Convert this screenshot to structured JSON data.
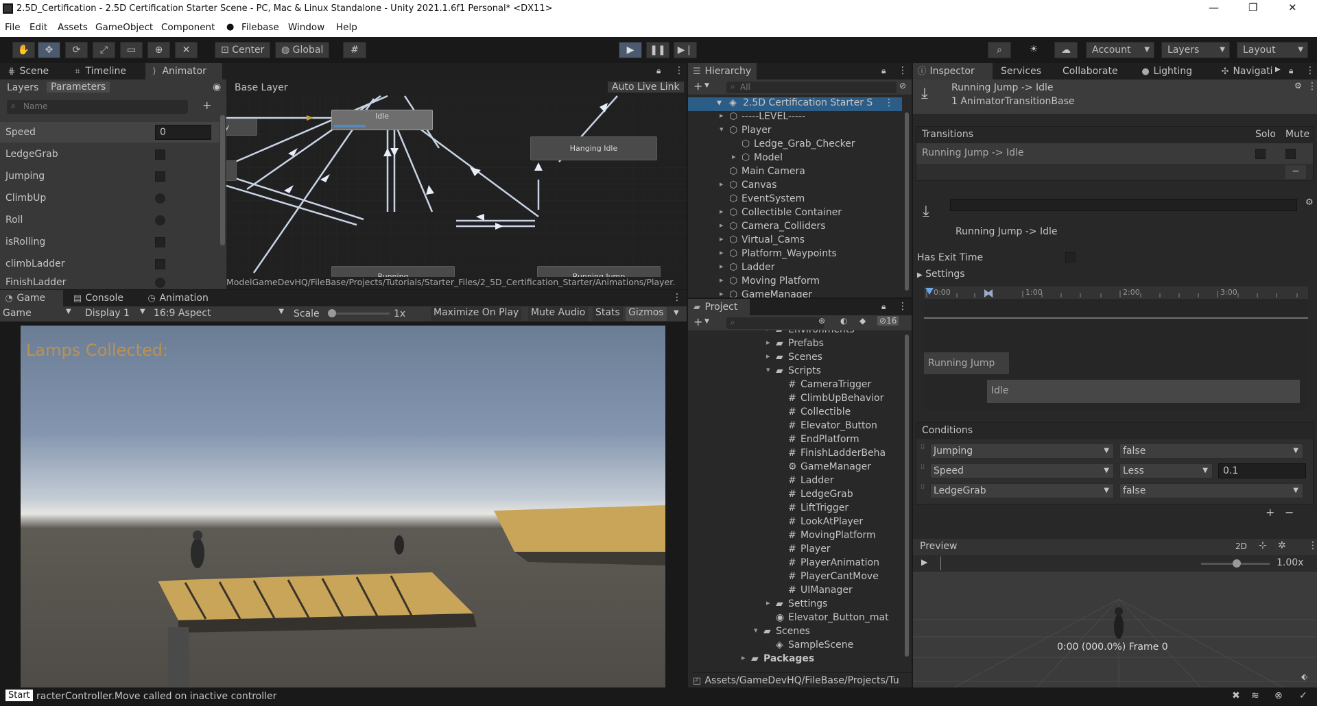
{
  "window": {
    "title": "2.5D_Certification - 2.5D Certification Starter Scene - PC, Mac & Linux Standalone - Unity 2021.1.6f1 Personal* <DX11>",
    "minimize": "—",
    "maximize": "❐",
    "close": "✕"
  },
  "menu": [
    "File",
    "Edit",
    "Assets",
    "GameObject",
    "Component",
    "Filebase",
    "Window",
    "Help"
  ],
  "toolbar": {
    "center": "Center",
    "global": "Global",
    "account": "Account",
    "layers": "Layers",
    "layout": "Layout"
  },
  "animator": {
    "tabs": [
      "Scene",
      "Timeline",
      "Animator"
    ],
    "subtabs": [
      "Layers",
      "Parameters"
    ],
    "search_placeholder": "Name",
    "layer": "Base Layer",
    "auto_live_link": "Auto Live Link",
    "path": "ModelGameDevHQ/FileBase/Projects/Tutorials/Starter_Files/2_5D_Certification_Starter/Animations/Player.",
    "parameters": [
      {
        "name": "Speed",
        "type": "float",
        "value": "0"
      },
      {
        "name": "LedgeGrab",
        "type": "bool"
      },
      {
        "name": "Jumping",
        "type": "bool"
      },
      {
        "name": "ClimbUp",
        "type": "trigger"
      },
      {
        "name": "Roll",
        "type": "trigger"
      },
      {
        "name": "isRolling",
        "type": "bool"
      },
      {
        "name": "climbLadder",
        "type": "bool"
      },
      {
        "name": "FinishLadder",
        "type": "trigger"
      }
    ],
    "states": {
      "idle": "Idle",
      "hanging_idle": "Hanging Idle",
      "running": "Running",
      "running_jump": "Running Jump",
      "partial": "y"
    }
  },
  "game": {
    "tabs": [
      "Game",
      "Console",
      "Animation"
    ],
    "display_mode": "Game",
    "display": "Display 1",
    "aspect": "16:9 Aspect",
    "scale_label": "Scale",
    "scale_value": "1x",
    "buttons": [
      "Maximize On Play",
      "Mute Audio",
      "Stats",
      "Gizmos"
    ],
    "hud_text": "Lamps Collected:"
  },
  "hierarchy": {
    "tab": "Hierarchy",
    "search_placeholder": "All",
    "scene": "2.5D Certification Starter S",
    "items": [
      {
        "label": "-----LEVEL-----",
        "indent": 1,
        "fold": "▸"
      },
      {
        "label": "Player",
        "indent": 1,
        "fold": "▾"
      },
      {
        "label": "Ledge_Grab_Checker",
        "indent": 2,
        "fold": ""
      },
      {
        "label": "Model",
        "indent": 2,
        "fold": "▸"
      },
      {
        "label": "Main Camera",
        "indent": 1,
        "fold": ""
      },
      {
        "label": "Canvas",
        "indent": 1,
        "fold": "▸"
      },
      {
        "label": "EventSystem",
        "indent": 1,
        "fold": ""
      },
      {
        "label": "Collectible Container",
        "indent": 1,
        "fold": "▸"
      },
      {
        "label": "Camera_Colliders",
        "indent": 1,
        "fold": "▸"
      },
      {
        "label": "Virtual_Cams",
        "indent": 1,
        "fold": "▸"
      },
      {
        "label": "Platform_Waypoints",
        "indent": 1,
        "fold": "▸"
      },
      {
        "label": "Ladder",
        "indent": 1,
        "fold": "▸"
      },
      {
        "label": "Moving Platform",
        "indent": 1,
        "fold": "▸"
      },
      {
        "label": "GameManager",
        "indent": 1,
        "fold": "▸"
      }
    ]
  },
  "project": {
    "tab": "Project",
    "hidden_count": "16",
    "items": [
      {
        "label": "Environments",
        "type": "folder",
        "indent": 1,
        "fold": "▸"
      },
      {
        "label": "Prefabs",
        "type": "folder",
        "indent": 1,
        "fold": "▸"
      },
      {
        "label": "Scenes",
        "type": "folder",
        "indent": 1,
        "fold": "▸"
      },
      {
        "label": "Scripts",
        "type": "folder",
        "indent": 1,
        "fold": "▾"
      },
      {
        "label": "CameraTrigger",
        "type": "script",
        "indent": 2
      },
      {
        "label": "ClimbUpBehavior",
        "type": "script",
        "indent": 2
      },
      {
        "label": "Collectible",
        "type": "script",
        "indent": 2
      },
      {
        "label": "Elevator_Button",
        "type": "script",
        "indent": 2
      },
      {
        "label": "EndPlatform",
        "type": "script",
        "indent": 2
      },
      {
        "label": "FinishLadderBeha",
        "type": "script",
        "indent": 2
      },
      {
        "label": "GameManager",
        "type": "gear",
        "indent": 2
      },
      {
        "label": "Ladder",
        "type": "script",
        "indent": 2
      },
      {
        "label": "LedgeGrab",
        "type": "script",
        "indent": 2
      },
      {
        "label": "LiftTrigger",
        "type": "script",
        "indent": 2
      },
      {
        "label": "LookAtPlayer",
        "type": "script",
        "indent": 2
      },
      {
        "label": "MovingPlatform",
        "type": "script",
        "indent": 2
      },
      {
        "label": "Player",
        "type": "script",
        "indent": 2
      },
      {
        "label": "PlayerAnimation",
        "type": "script",
        "indent": 2
      },
      {
        "label": "PlayerCantMove",
        "type": "script",
        "indent": 2
      },
      {
        "label": "UIManager",
        "type": "script",
        "indent": 2
      },
      {
        "label": "Settings",
        "type": "folder",
        "indent": 1,
        "fold": "▸"
      },
      {
        "label": "Elevator_Button_mat",
        "type": "material",
        "indent": 1
      },
      {
        "label": "Scenes",
        "type": "folder",
        "indent": 0,
        "fold": "▾"
      },
      {
        "label": "SampleScene",
        "type": "scene",
        "indent": 1
      },
      {
        "label": "Packages",
        "type": "folder",
        "indent": -1,
        "fold": "▸"
      }
    ],
    "path": "Assets/GameDevHQ/FileBase/Projects/Tu"
  },
  "inspector": {
    "tabs": [
      "Inspector",
      "Services",
      "Collaborate",
      "Lighting",
      "Navigati"
    ],
    "header_title": "Running Jump -> Idle",
    "header_sub": "1 AnimatorTransitionBase",
    "transitions_label": "Transitions",
    "solo": "Solo",
    "mute": "Mute",
    "transition_row": "Running Jump -> Idle",
    "transition_name": "Running Jump -> Idle",
    "has_exit_time": "Has Exit Time",
    "settings": "Settings",
    "timeline_ticks": [
      "0:00",
      "1:00",
      "2:00",
      "3:00"
    ],
    "timeline_bars": {
      "source": "Running Jump",
      "dest": "Idle"
    },
    "conditions_label": "Conditions",
    "conditions": [
      {
        "param": "Jumping",
        "op": "false",
        "value": ""
      },
      {
        "param": "Speed",
        "op": "Less",
        "value": "0.1"
      },
      {
        "param": "LedgeGrab",
        "op": "false",
        "value": ""
      }
    ],
    "preview_label": "Preview",
    "preview_2d": "2D",
    "preview_speed": "1.00x",
    "preview_time": "0:00 (000.0%) Frame 0"
  },
  "status": {
    "start": "Start",
    "message": "racterController.Move called on inactive controller"
  }
}
